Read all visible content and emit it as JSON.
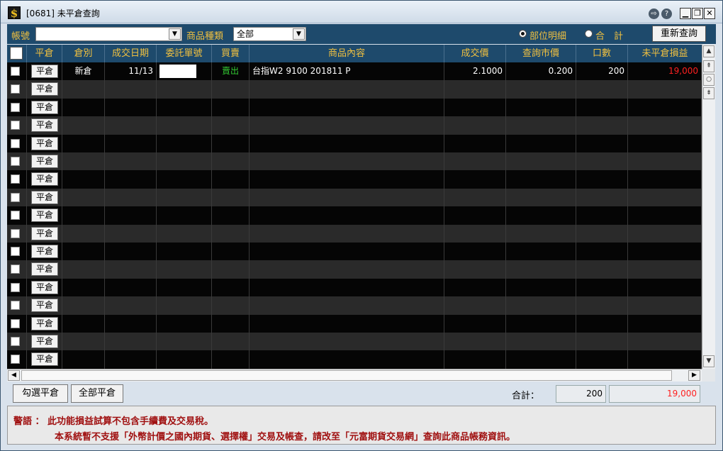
{
  "window": {
    "title": "[0681] 未平倉查詢",
    "logo": "$",
    "buttons": [
      "⇨",
      "?",
      "▁",
      "❐",
      "✕"
    ]
  },
  "toolbar": {
    "account_label": "帳號",
    "account_value": "",
    "product_type_label": "商品種類",
    "product_type_value": "全部",
    "radio_detail_label": "部位明細",
    "radio_total_label": "合　計",
    "requery_label": "重新查詢"
  },
  "table": {
    "columns": [
      "平倉",
      "倉別",
      "成交日期",
      "委託單號",
      "買賣",
      "商品內容",
      "成交價",
      "查詢市價",
      "口數",
      "未平倉損益"
    ],
    "close_button_label": "平倉",
    "rows": [
      {
        "position_type": "新倉",
        "date": "11/13",
        "order_no": "",
        "side": "賣出",
        "product": "台指W2 9100 201811 P",
        "price": "2.1000",
        "market_price": "0.200",
        "qty": "200",
        "pnl": "19,000"
      }
    ],
    "total_rows": 17
  },
  "footer": {
    "select_close_label": "勾選平倉",
    "all_close_label": "全部平倉",
    "total_label": "合計：",
    "total_qty": "200",
    "total_pnl": "19,000"
  },
  "warning": {
    "line1": "警語 ： 此功能損益試算不包含手續費及交易稅。",
    "line2": "本系統暫不支援「外幣計價之國內期貨、選擇權」交易及帳查，請改至「元富期貨交易網」查詢此商品帳務資訊。"
  },
  "colors": {
    "header_bg": "#1e4a6c",
    "header_text": "#f0c040",
    "sell": "#33cc33",
    "pnl_positive": "#ff2020",
    "warning_text": "#a01010"
  }
}
